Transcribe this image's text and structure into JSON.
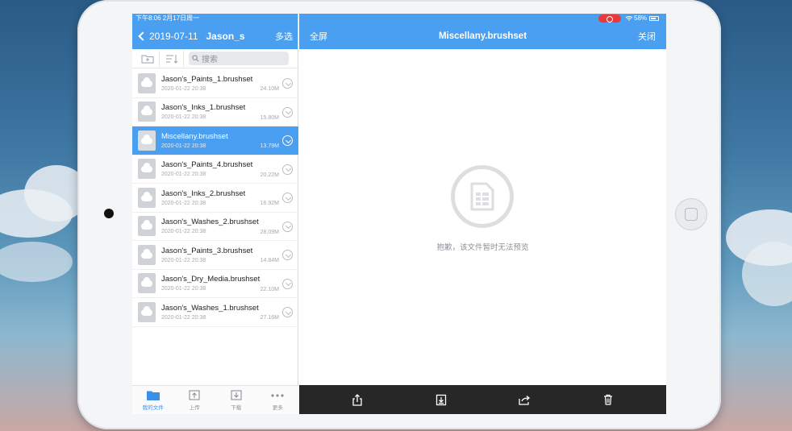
{
  "status_bar": {
    "time": "下午8:06  2月17日周一",
    "battery": "58%"
  },
  "left_nav": {
    "back_label": "2019-07-11",
    "folder_name": "Jason_s",
    "multi_select": "多选"
  },
  "search": {
    "placeholder": "搜索"
  },
  "files": [
    {
      "name": "Jason's_Paints_1.brushset",
      "date": "2020-01-22 20:38",
      "size": "24.10M",
      "selected": false
    },
    {
      "name": "Jason's_Inks_1.brushset",
      "date": "2020-01-22 20:38",
      "size": "15.80M",
      "selected": false
    },
    {
      "name": "Miscellany.brushset",
      "date": "2020-01-22 20:38",
      "size": "13.79M",
      "selected": true
    },
    {
      "name": "Jason's_Paints_4.brushset",
      "date": "2020-01-22 20:38",
      "size": "20.22M",
      "selected": false
    },
    {
      "name": "Jason's_Inks_2.brushset",
      "date": "2020-01-22 20:38",
      "size": "16.92M",
      "selected": false
    },
    {
      "name": "Jason's_Washes_2.brushset",
      "date": "2020-01-22 20:38",
      "size": "28.09M",
      "selected": false
    },
    {
      "name": "Jason's_Paints_3.brushset",
      "date": "2020-01-22 20:38",
      "size": "14.84M",
      "selected": false
    },
    {
      "name": "Jason's_Dry_Media.brushset",
      "date": "2020-01-22 20:38",
      "size": "22.10M",
      "selected": false
    },
    {
      "name": "Jason's_Washes_1.brushset",
      "date": "2020-01-22 20:38",
      "size": "27.16M",
      "selected": false
    }
  ],
  "tabs": [
    {
      "label": "我的文件",
      "icon": "folder-icon",
      "active": true
    },
    {
      "label": "上传",
      "icon": "upload-icon",
      "active": false
    },
    {
      "label": "下载",
      "icon": "download-icon",
      "active": false
    },
    {
      "label": "更多",
      "icon": "more-icon",
      "active": false
    }
  ],
  "right_nav": {
    "fullscreen": "全屏",
    "title": "Miscellany.brushset",
    "close": "关闭"
  },
  "preview": {
    "message": "抱歉，该文件暂时无法预览",
    "icon": "document-icon"
  },
  "bottom_actions": [
    {
      "name": "share-icon"
    },
    {
      "name": "download-icon"
    },
    {
      "name": "forward-icon"
    },
    {
      "name": "trash-icon"
    }
  ],
  "colors": {
    "accent": "#4a9ff0",
    "bottom_bar": "#272727",
    "selected_row": "#4a9ff0"
  }
}
